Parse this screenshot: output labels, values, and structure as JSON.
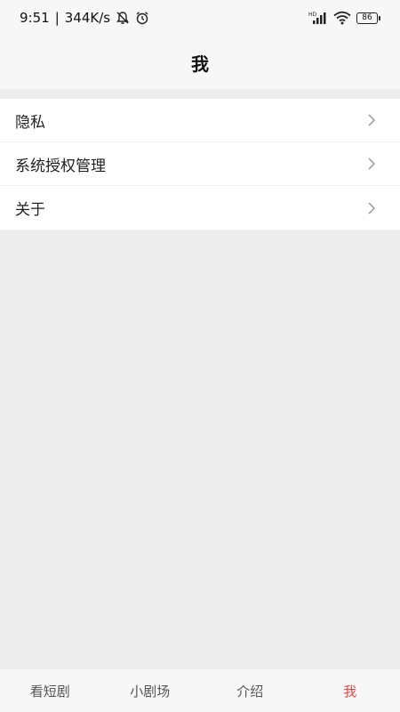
{
  "status_bar": {
    "time": "9:51",
    "separator": "|",
    "net_speed": "344K/s",
    "battery_level": "86",
    "hd_label": "HD",
    "icons": [
      "mute-notification-icon",
      "alarm-icon",
      "signal-icon",
      "wifi-icon",
      "battery-icon"
    ]
  },
  "header": {
    "title": "我"
  },
  "menu": {
    "items": [
      {
        "label": "隐私",
        "icon": "chevron-right-icon"
      },
      {
        "label": "系统授权管理",
        "icon": "chevron-right-icon"
      },
      {
        "label": "关于",
        "icon": "chevron-right-icon"
      }
    ]
  },
  "tabs": {
    "items": [
      {
        "label": "看短剧"
      },
      {
        "label": "小剧场"
      },
      {
        "label": "介绍"
      },
      {
        "label": "我"
      }
    ],
    "active_index": 3,
    "active_color": "#e04848",
    "inactive_color": "#555555"
  }
}
